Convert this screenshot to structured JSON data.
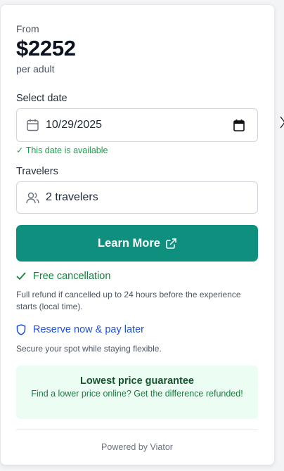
{
  "price_block": {
    "from_label": "From",
    "price": "$2252",
    "per_label": "per adult"
  },
  "date": {
    "label": "Select date",
    "value": "10/29/2025",
    "availability": "✓ This date is available"
  },
  "travelers": {
    "label": "Travelers",
    "value": "2 travelers"
  },
  "cta": {
    "label": "Learn More"
  },
  "free_cancellation": {
    "title": "Free cancellation",
    "description": "Full refund if cancelled up to 24 hours before the experience starts (local time)."
  },
  "reserve": {
    "title": "Reserve now & pay later",
    "description": "Secure your spot while staying flexible."
  },
  "guarantee": {
    "title": "Lowest price guarantee",
    "text": "Find a lower price online? Get the difference refunded!"
  },
  "footer": {
    "powered_by": "Powered by Viator"
  },
  "icons": {
    "date": "calendar-icon",
    "travelers": "users-icon",
    "cta": "external-link-icon",
    "cancellation": "check-icon",
    "reserve": "shield-icon"
  },
  "colors": {
    "accent": "#0f8f7e",
    "success": "#15803d",
    "link": "#1d4ed8",
    "guarantee_bg": "#ecfdf3"
  }
}
